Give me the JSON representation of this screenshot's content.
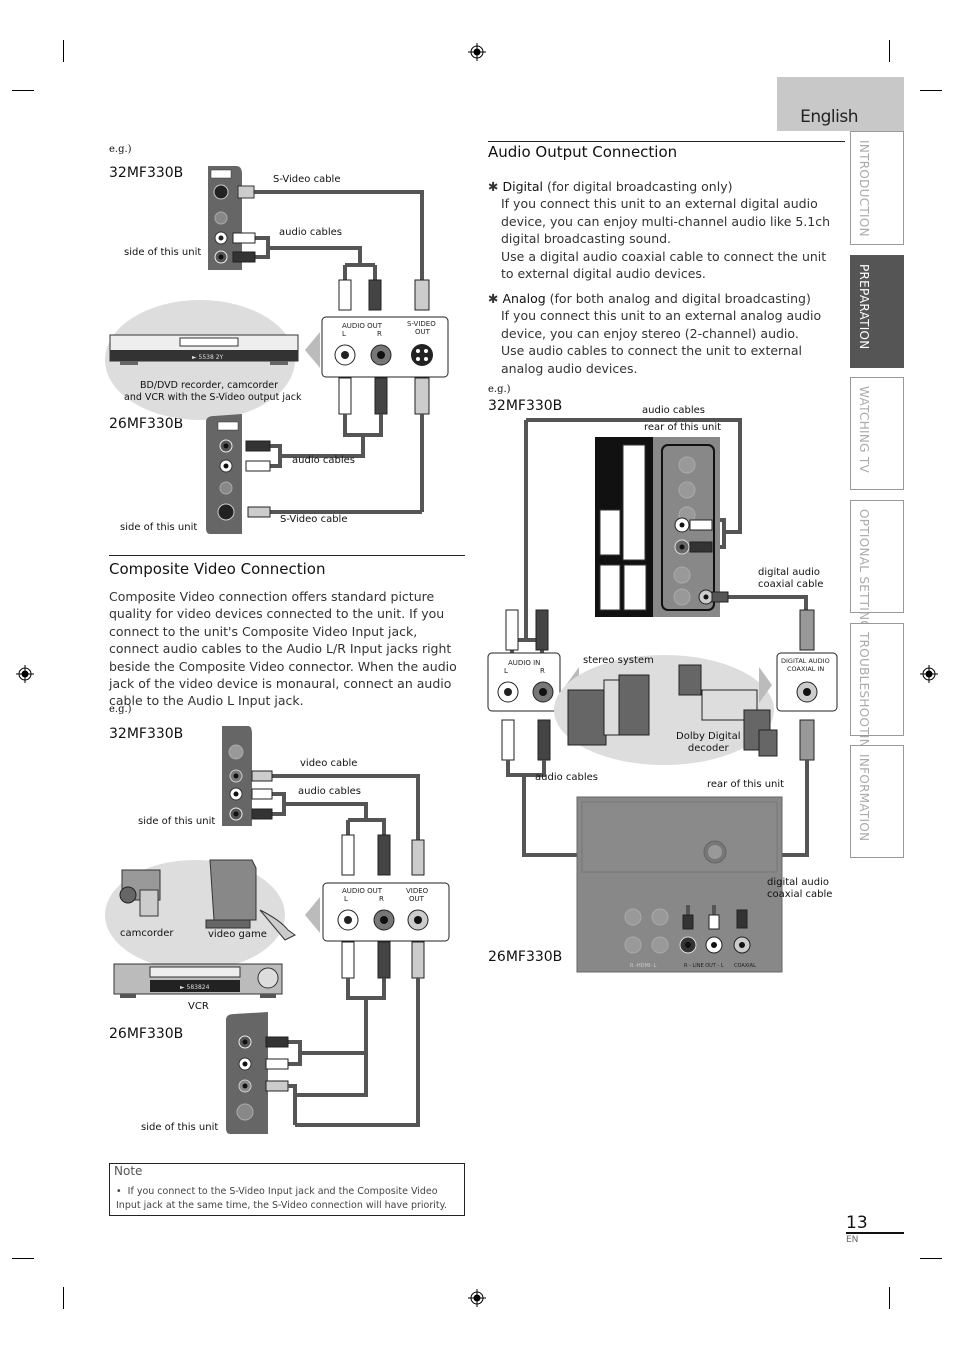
{
  "header": {
    "language_tab": "English"
  },
  "side_tabs": [
    {
      "label": "INTRODUCTION",
      "active": false
    },
    {
      "label": "PREPARATION",
      "active": true
    },
    {
      "label": "WATCHING TV",
      "active": false
    },
    {
      "label": "OPTIONAL SETTING",
      "active": false
    },
    {
      "label": "TROUBLESHOOTING",
      "active": false
    },
    {
      "label": "INFORMATION",
      "active": false
    }
  ],
  "svideo_section": {
    "eg": "e.g.)",
    "model_32": "32MF330B",
    "model_26": "26MF330B",
    "labels": {
      "svideo_cable": "S-Video cable",
      "audio_cables": "audio cables",
      "side_unit": "side of this unit",
      "device_line1": "BD/DVD recorder, camcorder",
      "device_line2": "and VCR with the S-Video output jack",
      "audio_out": "AUDIO OUT",
      "l": "L",
      "r": "R",
      "svideo_out_1": "S-VIDEO",
      "svideo_out_2": "OUT",
      "jack_video": "VIDEO",
      "jack_svideo": "S-VIDEO",
      "jack_audio": "AUDIO"
    }
  },
  "composite_section": {
    "title": "Composite Video Connection",
    "body": "Composite Video connection offers standard picture quality for video devices connected to the unit. If you connect to the unit's Composite Video Input jack, connect audio cables to the Audio L/R Input jacks right beside the Composite Video connector. When the audio jack of the video device is monaural, connect an audio cable to the Audio L Input jack.",
    "eg": "e.g.)",
    "model_32": "32MF330B",
    "model_26": "26MF330B",
    "labels": {
      "video_cable": "video cable",
      "audio_cables": "audio cables",
      "side_unit": "side of this unit",
      "camcorder": "camcorder",
      "video_game": "video game",
      "vcr": "VCR",
      "audio_out": "AUDIO OUT",
      "l": "L",
      "r": "R",
      "video_out_1": "VIDEO",
      "video_out_2": "OUT",
      "vcr_display": "► 583824"
    }
  },
  "note": {
    "title": "Note",
    "items": [
      "If you connect to the S-Video Input jack and the Composite Video Input jack at the same time, the S-Video connection will have priority."
    ]
  },
  "audio_output_section": {
    "title": "Audio Output Connection",
    "digital": {
      "symbol": "✱",
      "label": "Digital",
      "qualifier": "(for digital broadcasting only)",
      "line1": "If you connect this unit to an external digital audio device, you can enjoy multi-channel audio like 5.1ch digital broadcasting sound.",
      "line2": "Use a digital audio coaxial cable to connect the unit to external digital audio devices."
    },
    "analog": {
      "symbol": "✱",
      "label": "Analog",
      "qualifier": "(for both analog and digital broadcasting)",
      "line1": "If you connect this unit to an external analog audio device, you can enjoy stereo (2-channel) audio.",
      "line2": "Use audio cables to connect the unit to external analog audio devices."
    },
    "eg": "e.g.)",
    "model_32": "32MF330B",
    "model_26": "26MF330B",
    "labels": {
      "audio_cables_top": "audio cables",
      "rear_unit_top": "rear of this unit",
      "digital_coax_top_1": "digital audio",
      "digital_coax_top_2": "coaxial cable",
      "audio_in": "AUDIO IN",
      "l": "L",
      "r": "R",
      "stereo_system": "stereo system",
      "dolby_1": "Dolby Digital",
      "dolby_2": "decoder",
      "digital_audio_in_1": "DIGITAL AUDIO",
      "digital_audio_in_2": "COAXIAL  IN",
      "audio_cables_bottom": "audio cables",
      "rear_unit_bottom": "rear of this unit",
      "digital_coax_bottom_1": "digital audio",
      "digital_coax_bottom_2": "coaxial cable",
      "hdmi_lr": "R -HDMI- L",
      "line_out": "R - LINE OUT - L",
      "coaxial": "COAXIAL"
    }
  },
  "footer": {
    "page_number": "13",
    "lang_code": "EN"
  }
}
